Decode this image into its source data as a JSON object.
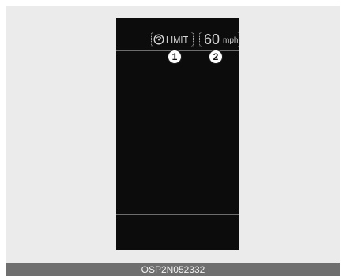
{
  "display": {
    "limit_label": "LIMIT",
    "speed_value": "60",
    "speed_unit": "mph",
    "icon": "speed-limiter-icon"
  },
  "callouts": [
    "1",
    "2"
  ],
  "caption": "OSP2N052332",
  "colors": {
    "background": "#ebebeb",
    "display": "#0c0c0c",
    "caption_bar": "#6f6f6f"
  }
}
